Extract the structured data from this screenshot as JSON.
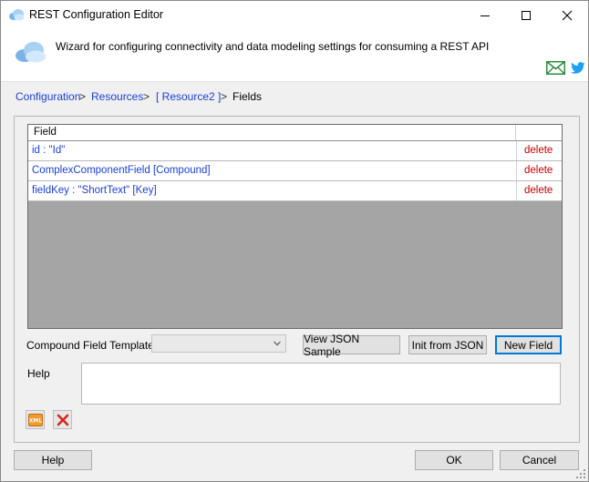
{
  "window": {
    "title": "REST Configuration Editor"
  },
  "header": {
    "description": "Wizard for configuring connectivity and data modeling settings for consuming a REST API"
  },
  "breadcrumb": {
    "items": [
      {
        "label": "Configuration"
      },
      {
        "label": "Resources"
      },
      {
        "label": "[ Resource2 ]"
      },
      {
        "label": "Fields"
      }
    ],
    "separator": ">"
  },
  "grid": {
    "column_field": "Field",
    "rows": [
      {
        "field": "id : \"Id\"",
        "action": "delete"
      },
      {
        "field": "ComplexComponentField [Compound]",
        "action": "delete"
      },
      {
        "field": "fieldKey : \"ShortText\" [Key]",
        "action": "delete"
      }
    ]
  },
  "controls": {
    "compound_label": "Compound Field Template",
    "compound_value": "",
    "view_json_label": "View JSON Sample",
    "init_json_label": "Init from JSON",
    "new_field_label": "New Field",
    "help_label": "Help",
    "help_text": ""
  },
  "footer": {
    "help_button": "Help",
    "ok_button": "OK",
    "cancel_button": "Cancel"
  },
  "colors": {
    "link": "#1a3fd8",
    "delete": "#c00000",
    "grid_empty": "#a5a5a5",
    "twitter": "#1da1f2",
    "mail": "#2e8b3e"
  },
  "icons": [
    "cloud-icon",
    "minimize-icon",
    "maximize-icon",
    "close-icon",
    "mail-icon",
    "twitter-icon",
    "chevron-down-icon",
    "xml-icon",
    "delete-x-icon",
    "resize-grip-icon"
  ]
}
